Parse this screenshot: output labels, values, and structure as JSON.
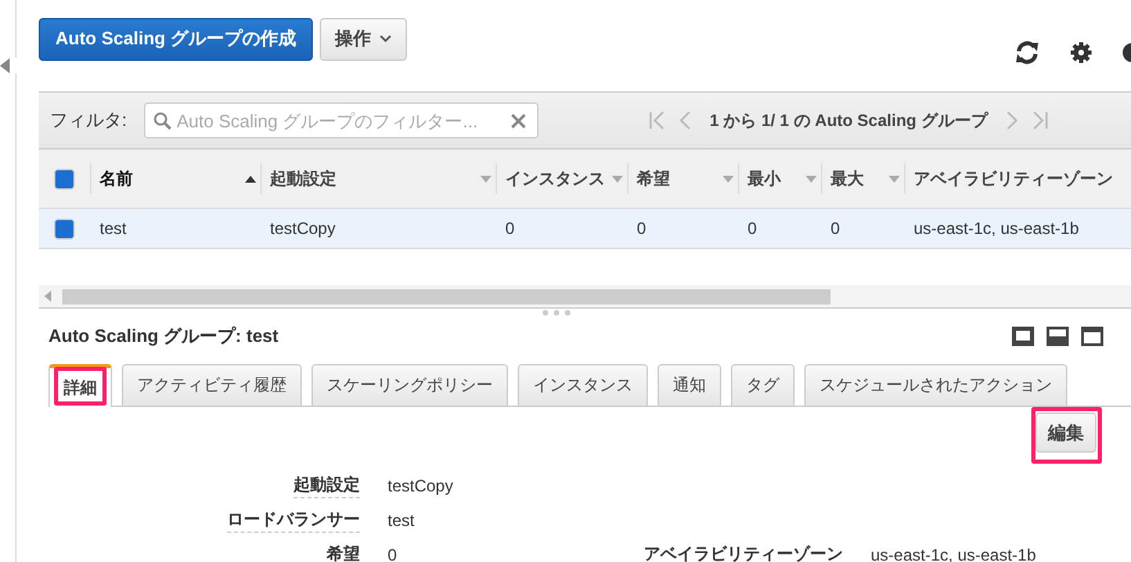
{
  "toolbar": {
    "create_button": "Auto Scaling グループの作成",
    "actions_button": "操作"
  },
  "filter": {
    "label": "フィルタ:",
    "placeholder": "Auto Scaling グループのフィルター..."
  },
  "pagination": {
    "text": "1 から 1/ 1 の Auto Scaling グループ"
  },
  "table": {
    "header_checked": true,
    "columns": [
      {
        "label": "名前",
        "sortable": true,
        "sorted": true
      },
      {
        "label": "起動設定",
        "sortable": true,
        "sorted": false
      },
      {
        "label": "インスタンス",
        "sortable": true,
        "sorted": false
      },
      {
        "label": "希望",
        "sortable": true,
        "sorted": false
      },
      {
        "label": "最小",
        "sortable": true,
        "sorted": false
      },
      {
        "label": "最大",
        "sortable": true,
        "sorted": false
      },
      {
        "label": "アベイラビリティーゾーン",
        "sortable": false,
        "sorted": false
      }
    ],
    "rows": [
      {
        "selected": true,
        "checked": true,
        "cells": [
          "test",
          "testCopy",
          "0",
          "0",
          "0",
          "0",
          "us-east-1c, us-east-1b"
        ]
      }
    ]
  },
  "details": {
    "title": "Auto Scaling グループ: test",
    "tabs": [
      {
        "label": "詳細",
        "selected": true,
        "highlighted": true
      },
      {
        "label": "アクティビティ履歴",
        "selected": false,
        "highlighted": false
      },
      {
        "label": "スケーリングポリシー",
        "selected": false,
        "highlighted": false
      },
      {
        "label": "インスタンス",
        "selected": false,
        "highlighted": false
      },
      {
        "label": "通知",
        "selected": false,
        "highlighted": false
      },
      {
        "label": "タグ",
        "selected": false,
        "highlighted": false
      },
      {
        "label": "スケジュールされたアクション",
        "selected": false,
        "highlighted": false
      }
    ],
    "edit_button": {
      "label": "編集",
      "highlighted": true
    },
    "rows": [
      [
        {
          "label": "起動設定",
          "value": "testCopy"
        }
      ],
      [
        {
          "label": "ロードバランサー",
          "value": "test"
        }
      ],
      [
        {
          "label": "希望",
          "value": "0"
        },
        {
          "label": "アベイラビリティーゾーン",
          "value": "us-east-1c, us-east-1b"
        }
      ]
    ]
  }
}
